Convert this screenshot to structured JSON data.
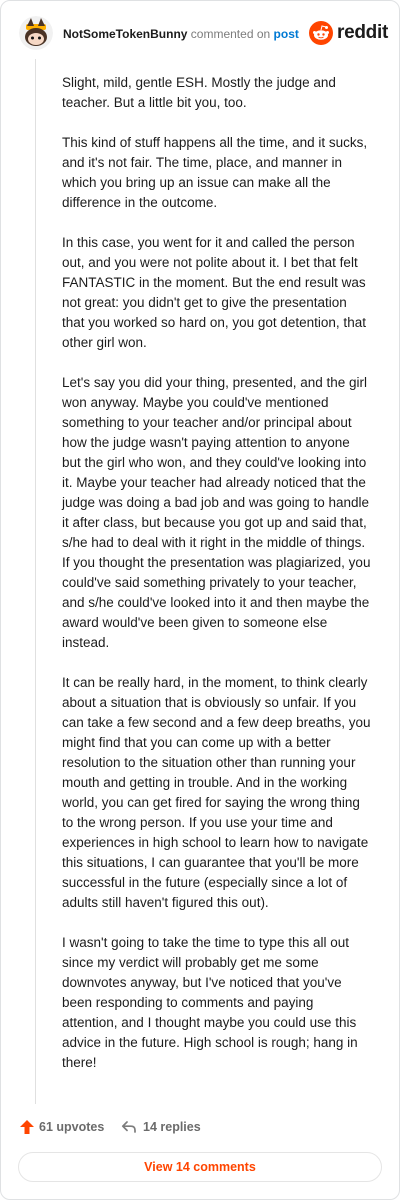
{
  "header": {
    "author": "NotSomeTokenBunny",
    "commented_on": "commented on",
    "post_link": "post",
    "brand": "reddit"
  },
  "comment": {
    "paragraphs": [
      "Slight, mild, gentle ESH. Mostly the judge and teacher. But a little bit you, too.",
      "This kind of stuff happens all the time, and it sucks, and it's not fair. The time, place, and manner in which you bring up an issue can make all the difference in the outcome.",
      "In this case, you went for it and called the person out, and you were not polite about it. I bet that felt FANTASTIC in the moment. But the end result was not great: you didn't get to give the presentation that you worked so hard on, you got detention, that other girl won.",
      "Let's say you did your thing, presented, and the girl won anyway. Maybe you could've mentioned something to your teacher and/or principal about how the judge wasn't paying attention to anyone but the girl who won, and they could've looking into it. Maybe your teacher had already noticed that the judge was doing a bad job and was going to handle it after class, but because you got up and said that, s/he had to deal with it right in the middle of things. If you thought the presentation was plagiarized, you could've said something privately to your teacher, and s/he could've looked into it and then maybe the award would've been given to someone else instead.",
      "It can be really hard, in the moment, to think clearly about a situation that is obviously so unfair. If you can take a few second and a few deep breaths, you might find that you can come up with a better resolution to the situation other than running your mouth and getting in trouble. And in the working world, you can get fired for saying the wrong thing to the wrong person. If you use your time and experiences in high school to learn how to navigate this situations, I can guarantee that you'll be more successful in the future (especially since a lot of adults still haven't figured this out).",
      "I wasn't going to take the time to type this all out since my verdict will probably get me some downvotes anyway, but I've noticed that you've been responding to comments and paying attention, and I thought maybe you could use this advice in the future. High school is rough; hang in there!"
    ]
  },
  "footer": {
    "upvotes": "61 upvotes",
    "replies": "14 replies",
    "view_comments": "View 14 comments"
  },
  "colors": {
    "accent": "#ff4500",
    "link": "#0079d3"
  },
  "icons": {
    "avatar": "snoo-avatar",
    "brand": "reddit-logo-icon",
    "upvote": "upvote-arrow-icon",
    "reply": "reply-arrow-icon"
  }
}
